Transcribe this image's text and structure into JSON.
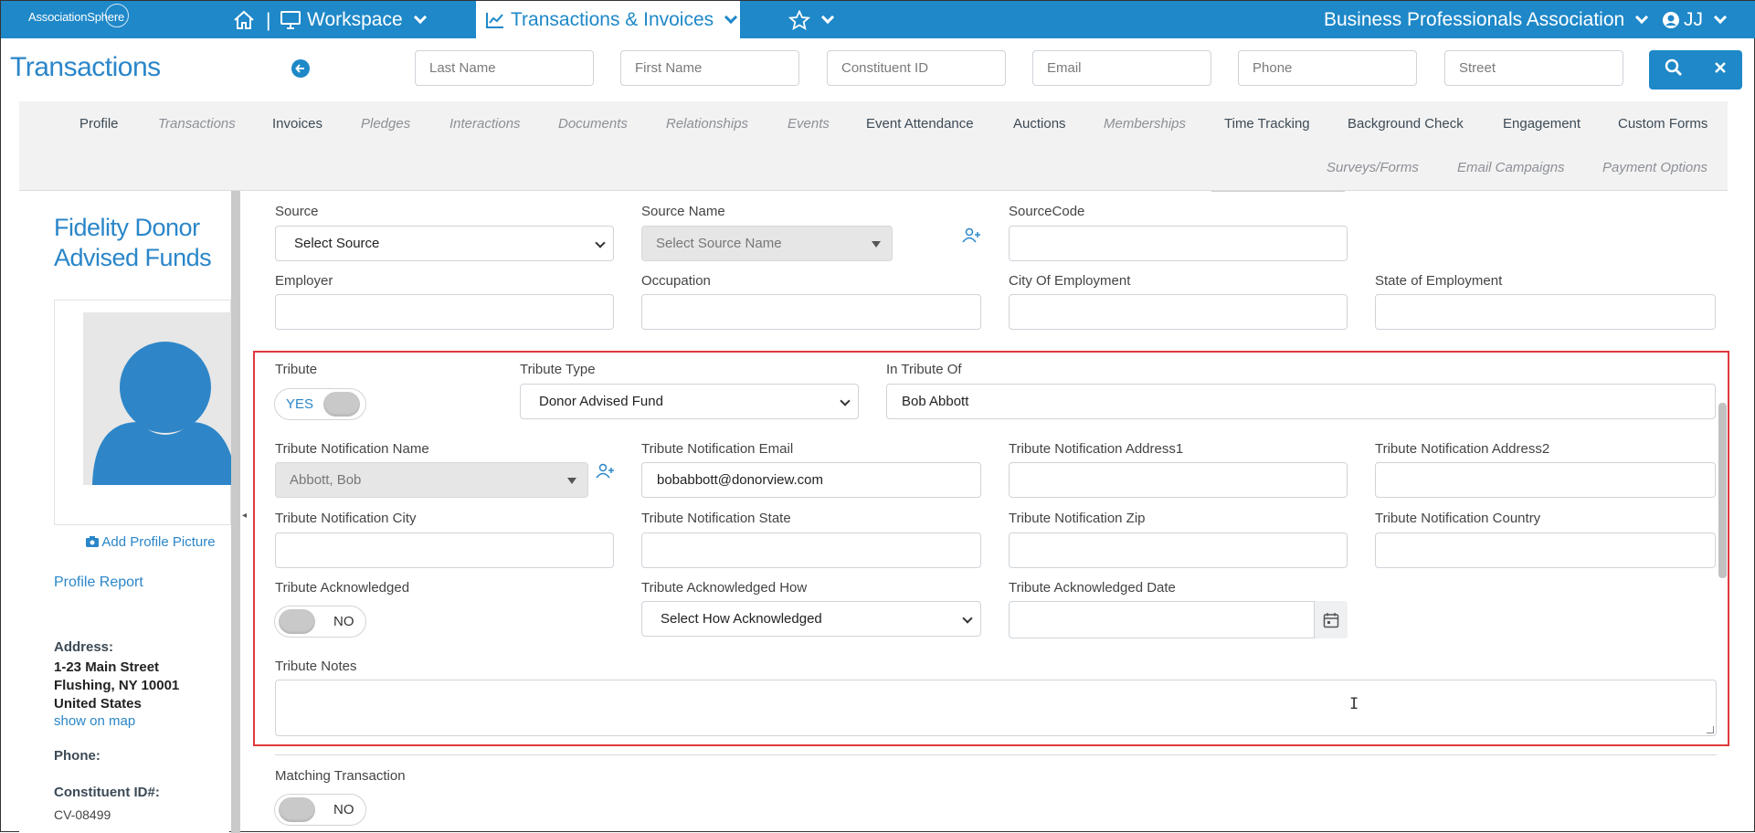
{
  "topbar": {
    "logo": "AssociationSphere",
    "workspace": "Workspace",
    "active_menu": "Transactions & Invoices",
    "org": "Business Professionals Association",
    "user": "JJ",
    "separator": "|"
  },
  "header": {
    "title": "Transactions",
    "search": {
      "last_name": "Last Name",
      "first_name": "First Name",
      "constituent_id": "Constituent ID",
      "email": "Email",
      "phone": "Phone",
      "street": "Street"
    }
  },
  "tabs": [
    {
      "label": "Profile",
      "italic": false
    },
    {
      "label": "Transactions",
      "italic": true
    },
    {
      "label": "Invoices",
      "italic": false
    },
    {
      "label": "Pledges",
      "italic": true
    },
    {
      "label": "Interactions",
      "italic": true
    },
    {
      "label": "Documents",
      "italic": true
    },
    {
      "label": "Relationships",
      "italic": true
    },
    {
      "label": "Events",
      "italic": true
    },
    {
      "label": "Event Attendance",
      "italic": false
    },
    {
      "label": "Auctions",
      "italic": false
    },
    {
      "label": "Memberships",
      "italic": true
    },
    {
      "label": "Time Tracking",
      "italic": false
    },
    {
      "label": "Background Check",
      "italic": false
    },
    {
      "label": "Engagement",
      "italic": false
    },
    {
      "label": "Custom Forms",
      "italic": false
    },
    {
      "label": "Surveys/Forms",
      "italic": true
    },
    {
      "label": "Email Campaigns",
      "italic": true
    },
    {
      "label": "Payment Options",
      "italic": true
    }
  ],
  "profile": {
    "name_line1": "Fidelity Donor",
    "name_line2": "Advised Funds",
    "add_picture": "Add Profile Picture",
    "report": "Profile Report",
    "address_label": "Address:",
    "address_line1": "1-23 Main Street",
    "address_line2": "Flushing, NY 10001",
    "address_line3": "United States",
    "map_link": "show on map",
    "phone_label": "Phone:",
    "cid_label": "Constituent ID#:",
    "cid_value": "CV-08499"
  },
  "form": {
    "source_label": "Source",
    "source_value": "Select Source",
    "source_name_label": "Source Name",
    "source_name_value": "Select Source Name",
    "source_code_label": "SourceCode",
    "employer_label": "Employer",
    "occupation_label": "Occupation",
    "city_employment_label": "City Of Employment",
    "state_employment_label": "State of Employment",
    "tribute_label": "Tribute",
    "tribute_toggle": "YES",
    "tribute_type_label": "Tribute Type",
    "tribute_type_value": "Donor Advised Fund",
    "in_tribute_of_label": "In Tribute Of",
    "in_tribute_of_value": "Bob Abbott",
    "notif_name_label": "Tribute Notification Name",
    "notif_name_value": "Abbott, Bob",
    "notif_email_label": "Tribute Notification Email",
    "notif_email_value": "bobabbott@donorview.com",
    "notif_addr1_label": "Tribute Notification Address1",
    "notif_addr2_label": "Tribute Notification Address2",
    "notif_city_label": "Tribute Notification City",
    "notif_state_label": "Tribute Notification State",
    "notif_zip_label": "Tribute Notification Zip",
    "notif_country_label": "Tribute Notification Country",
    "ack_label": "Tribute Acknowledged",
    "ack_toggle": "NO",
    "ack_how_label": "Tribute Acknowledged How",
    "ack_how_value": "Select How Acknowledged",
    "ack_date_label": "Tribute Acknowledged Date",
    "notes_label": "Tribute Notes",
    "matching_label": "Matching Transaction",
    "matching_toggle": "NO"
  },
  "colors": {
    "brand": "#1e88c8",
    "highlight": "#e0393e"
  }
}
